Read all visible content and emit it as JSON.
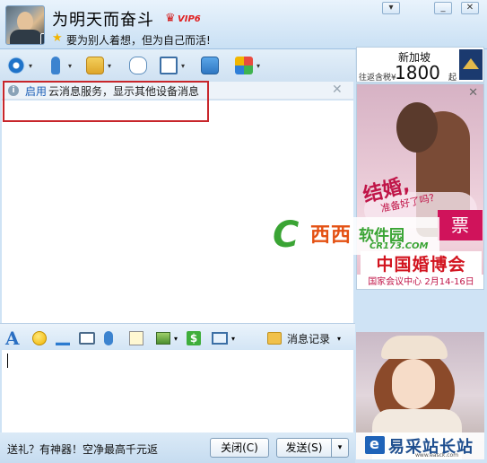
{
  "window": {
    "minimize_label": "_",
    "close_label": "✕",
    "menu_label": "▾"
  },
  "profile": {
    "nickname": "为明天而奋斗",
    "vip_label": "VIP6",
    "signature": "要为别人着想，但为自己而活!"
  },
  "notice": {
    "link_text": "启用",
    "message": "云消息服务，显示其他设备消息",
    "close_label": "✕"
  },
  "ads": {
    "top": {
      "destination": "新加坡",
      "prefix": "往返含税¥",
      "price": "1800",
      "suffix": "起"
    },
    "main": {
      "close_label": "✕",
      "slogan": "结婚,",
      "slogan_sub": "准备好了吗?",
      "ticket": "票",
      "title": "中国婚博会",
      "venue": "国家会议中心  2月14-16日"
    },
    "watermark": {
      "logo_letter": "C",
      "name": "西西",
      "name2": "软件园",
      "url": "CR173.COM"
    },
    "bottom": {
      "brand": "易采站长站",
      "site": "www.easck.com"
    }
  },
  "input_toolbar": {
    "font_label": "A",
    "history_label": "消息记录"
  },
  "bottom_bar": {
    "promo": "送礼？有神器！空净最高千元返",
    "close_button": "关闭(C)",
    "send_button": "发送(S)",
    "send_dropdown": "▾"
  },
  "colors": {
    "header_bg": "#c9e0f4",
    "accent_link": "#1c5fb7",
    "highlight_frame": "#c8262b"
  }
}
